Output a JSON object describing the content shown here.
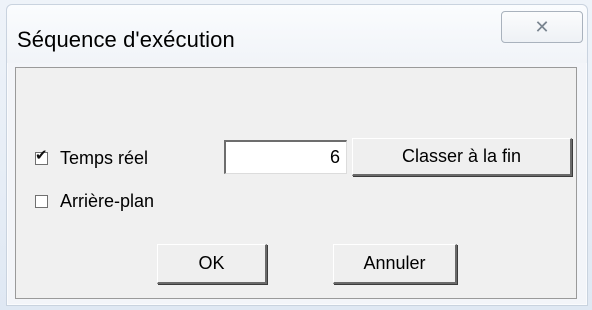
{
  "window": {
    "title": "Séquence d'exécution",
    "close_glyph": "✕"
  },
  "options": {
    "realtime": {
      "label": "Temps réel",
      "checked": true,
      "check_glyph": "✔"
    },
    "background": {
      "label": "Arrière-plan",
      "checked": false
    },
    "value": "6"
  },
  "buttons": {
    "sort_to_end": "Classer à la fin",
    "ok": "OK",
    "cancel": "Annuler"
  },
  "icons": {
    "close": "close-icon",
    "check": "checkmark-icon"
  }
}
